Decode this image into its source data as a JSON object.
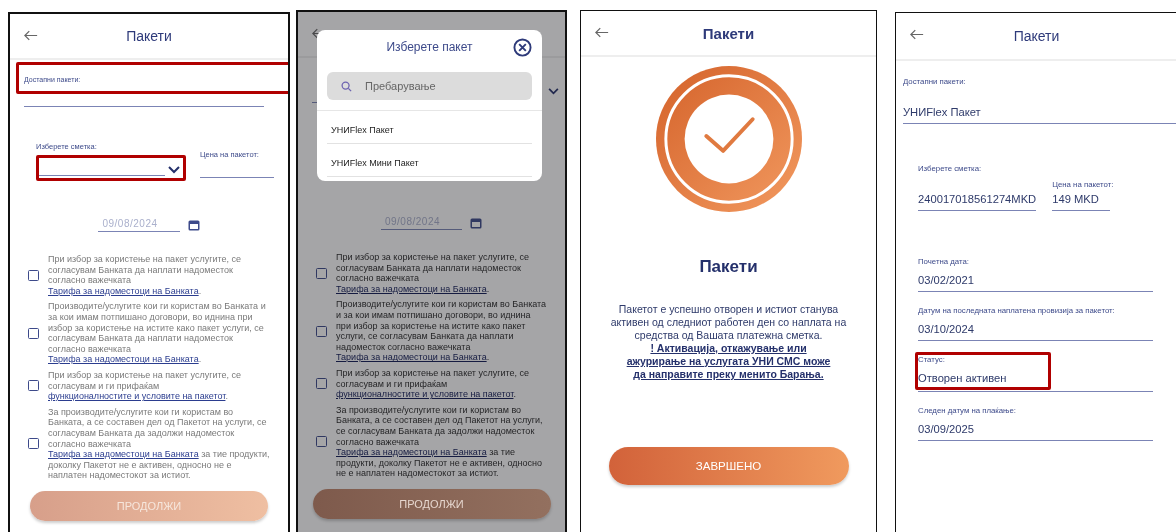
{
  "screen_select": {
    "title": "Пакети",
    "package_field": {
      "label": "Достапни пакети:",
      "highlighted": true
    },
    "account_field": {
      "label": "Изберете сметка:",
      "highlighted": true
    },
    "price_field": {
      "label": "Цена на пакетот:",
      "highlighted": false
    },
    "date": "09/08/2024",
    "agreements": [
      {
        "checked": false,
        "parts": [
          {
            "text": "При избор за користење на пакет услугите, се согласувам Банката да наплати надоместок согласно важечката ",
            "link": false
          },
          {
            "text": "Тарифа за надоместоци на Банката",
            "link": true
          },
          {
            "text": ".",
            "link": false
          }
        ]
      },
      {
        "checked": false,
        "parts": [
          {
            "text": "Производите/услугите кои ги користам во Банката и за кои имам потпишано договори, во иднина при избор за користење на истите како пакет услуги, се согласувам Банката да наплати надоместок согласно важечката ",
            "link": false
          },
          {
            "text": "Тарифа за надоместоци на Банката",
            "link": true
          },
          {
            "text": ".",
            "link": false
          }
        ]
      },
      {
        "checked": false,
        "parts": [
          {
            "text": "При избор за користење на пакет услугите, се согласувам и ги прифаќам ",
            "link": false
          },
          {
            "text": "функционалностите и условите на пакетот",
            "link": true
          },
          {
            "text": ".",
            "link": false
          }
        ]
      },
      {
        "checked": false,
        "parts": [
          {
            "text": "За производите/услугите кои ги користам во Банката, а се составен дел од Пакетот на услуги, се согласувам Банката да задолжи надоместок согласно важечката ",
            "link": false
          },
          {
            "text": "Тарифа за надоместоци на Банката",
            "link": true
          },
          {
            "text": " за тие продукти, доколку Пакетот не е активен, односно не е наплатен надоместокот за истиот.",
            "link": false
          }
        ]
      }
    ],
    "button": {
      "label": "ПРОДОЛЖИ",
      "disabled": true
    }
  },
  "screen_picker": {
    "dialog": {
      "title": "Изберете пакет",
      "search": {
        "placeholder": "Пребарување"
      },
      "options": [
        {
          "label": "УНИFlex Пакет"
        },
        {
          "label": "УНИFlex Мини Пакет"
        }
      ]
    },
    "date": "09/08/2024",
    "agreements": [
      {
        "checked": false,
        "parts": [
          {
            "text": "При избор за користење на пакет услугите, се согласувам Банката да наплати надоместок согласно важечката ",
            "link": false
          },
          {
            "text": "Тарифа за надоместоци на Банката",
            "link": true
          },
          {
            "text": ".",
            "link": false
          }
        ]
      },
      {
        "checked": false,
        "parts": [
          {
            "text": "Производите/услугите кои ги користам во Банката и за кои имам потпишано договори, во иднина при избор за користење на истите како пакет услуги, се согласувам Банката да наплати надоместок согласно важечката ",
            "link": false
          },
          {
            "text": "Тарифа за надоместоци на Банката",
            "link": true
          },
          {
            "text": ".",
            "link": false
          }
        ]
      },
      {
        "checked": false,
        "parts": [
          {
            "text": "При избор за користење на пакет услугите, се согласувам и ги прифаќам ",
            "link": false
          },
          {
            "text": "функционалностите и условите на пакетот",
            "link": true
          },
          {
            "text": ".",
            "link": false
          }
        ]
      },
      {
        "checked": false,
        "parts": [
          {
            "text": "За производите/услугите кои ги користам во Банката, а се составен дел од Пакетот на услуги, се согласувам Банката да задолжи надоместок согласно важечката ",
            "link": false
          },
          {
            "text": "Тарифа за надоместоци на Банката",
            "link": true
          },
          {
            "text": " за тие продукти, доколку Пакетот не е активен, односно не е наплатен надоместокот за истиот.",
            "link": false
          }
        ]
      }
    ],
    "button": {
      "label": "ПРОДОЛЖИ",
      "disabled": true
    }
  },
  "screen_success": {
    "title": "Пакети",
    "heading": "Пакети",
    "message": "Пакетот е успешно отворен и истиот станува активен од следниот работен ден со наплата на средства од Вашата платежна сметка.",
    "notice_link": "! Активација, откажување или ажурирање на услугата УНИ СМС може да направите преку менито Барања.",
    "button": {
      "label": "ЗАВРШЕНО",
      "disabled": false
    }
  },
  "screen_details": {
    "title": "Пакети",
    "package_field": {
      "label": "Достапни пакети:",
      "value": "УНИFlex Пакет"
    },
    "account_field": {
      "label": "Изберете сметка:",
      "value": "240017018561274MKD"
    },
    "price_field": {
      "label": "Цена на пакетот:",
      "value": "149 MKD"
    },
    "fields": [
      {
        "label": "Почетна дата:",
        "value": "03/02/2021",
        "highlighted": false
      },
      {
        "label": "Датум на последната наплатена провизија за пакетот:",
        "value": "03/10/2024",
        "highlighted": false
      },
      {
        "label": "Статус:",
        "value": "Отворен активен",
        "highlighted": true
      },
      {
        "label": "Следен датум на плаќање:",
        "value": "03/09/2025",
        "highlighted": false
      }
    ]
  }
}
